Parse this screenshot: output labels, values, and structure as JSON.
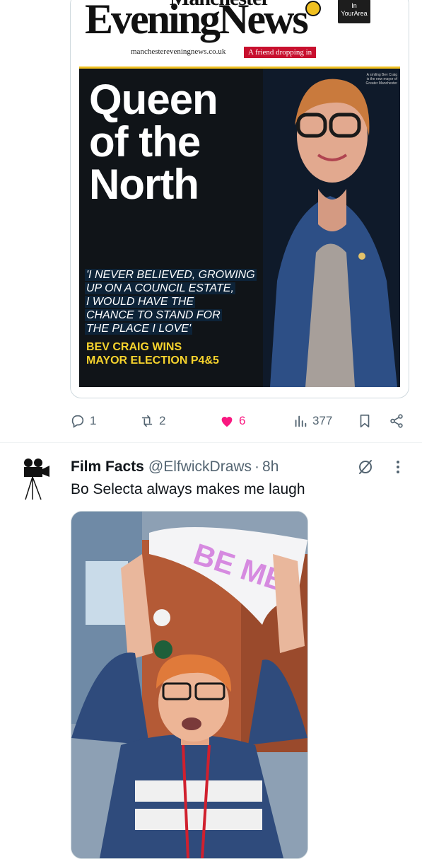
{
  "card": {
    "masthead": {
      "city": "Manchester",
      "title": "EveningNews",
      "url": "manchestereveningnews.co.uk",
      "tagline": "A friend dropping in",
      "badge_line1": "In",
      "badge_line2": "YourArea"
    },
    "cover": {
      "headline_lines": [
        "Queen",
        "of the",
        "North"
      ],
      "quote_lines": [
        "'I NEVER BELIEVED, GROWING",
        "UP ON A COUNCIL ESTATE,",
        "I WOULD HAVE THE",
        "CHANCE TO STAND FOR",
        "THE PLACE I LOVE'"
      ],
      "sub_lines": [
        "BEV CRAIG WINS",
        "MAYOR ELECTION P4&5"
      ],
      "photo_caption": "A smiling Bev Craig is the new mayor of Greater Manchester"
    }
  },
  "actions": {
    "replies": "1",
    "reposts": "2",
    "likes": "6",
    "views": "377",
    "icons": [
      "reply-icon",
      "repost-icon",
      "heart-icon",
      "views-icon",
      "bookmark-icon",
      "share-icon"
    ],
    "like_color": "#f91880",
    "icon_color": "#536471"
  },
  "tweet": {
    "name": "Film Facts",
    "handle": "@ElfwickDraws",
    "separator": "·",
    "time": "8h",
    "text": "Bo Selecta always makes me laugh",
    "media_sign_text": "BE ME"
  }
}
